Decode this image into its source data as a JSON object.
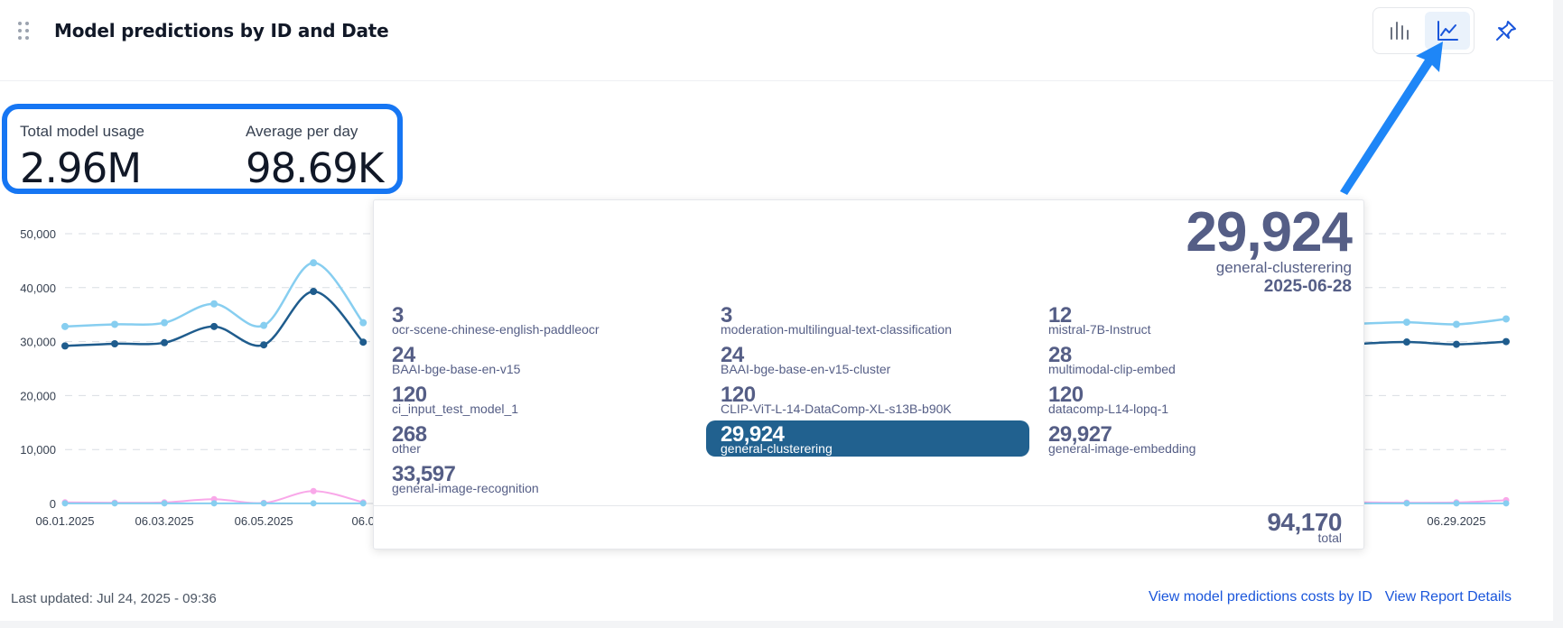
{
  "header": {
    "title": "Model predictions by ID and Date",
    "view_toggle": {
      "bar_icon": "bar-chart-icon",
      "line_icon": "line-chart-icon",
      "active": "line"
    },
    "pin_icon": "pin-icon"
  },
  "kpis": {
    "total_label": "Total model usage",
    "total_value": "2.96M",
    "avg_label": "Average per day",
    "avg_value": "98.69K"
  },
  "colors": {
    "accent": "#1676f3",
    "series_light": "#87cef0",
    "series_dark": "#1f5c8d",
    "series_pink": "#f9a8e9",
    "tooltip_text": "#555e86",
    "tooltip_highlight": "#21618f",
    "link": "#1a56db"
  },
  "chart_data": {
    "type": "line",
    "x_tick_labels": [
      "06.01.2025",
      "06.03.2025",
      "06.05.2025",
      "06.0",
      "06.29.2025"
    ],
    "y_tick_labels": [
      "0",
      "10,000",
      "20,000",
      "30,000",
      "40,000",
      "50,000"
    ],
    "ylim": [
      0,
      50000
    ],
    "grid": true,
    "series": [
      {
        "x": [
          "06.01.2025",
          "06.02.2025",
          "06.03.2025",
          "06.04.2025",
          "06.05.2025",
          "06.06.2025",
          "06.07.2025",
          "06.26.2025",
          "06.27.2025",
          "06.28.2025",
          "06.29.2025",
          "06.30.2025"
        ],
        "values": [
          32800,
          33200,
          33500,
          37000,
          33000,
          44600,
          33500,
          33200,
          33300,
          33600,
          33200,
          34200
        ]
      },
      {
        "x": [
          "06.01.2025",
          "06.02.2025",
          "06.03.2025",
          "06.04.2025",
          "06.05.2025",
          "06.06.2025",
          "06.07.2025",
          "06.26.2025",
          "06.27.2025",
          "06.28.2025",
          "06.29.2025",
          "06.30.2025"
        ],
        "values": [
          29200,
          29600,
          29800,
          32800,
          29400,
          39300,
          29900,
          29400,
          29600,
          29924,
          29500,
          30000
        ]
      },
      {
        "x": [
          "06.01.2025",
          "06.02.2025",
          "06.03.2025",
          "06.04.2025",
          "06.05.2025",
          "06.06.2025",
          "06.07.2025",
          "06.26.2025",
          "06.27.2025",
          "06.28.2025",
          "06.29.2025",
          "06.30.2025"
        ],
        "values": [
          200,
          150,
          200,
          800,
          100,
          2300,
          200,
          150,
          200,
          150,
          200,
          600
        ]
      },
      {
        "x": [
          "06.01.2025",
          "06.02.2025",
          "06.03.2025",
          "06.04.2025",
          "06.05.2025",
          "06.06.2025",
          "06.07.2025",
          "06.26.2025",
          "06.27.2025",
          "06.28.2025",
          "06.29.2025",
          "06.30.2025"
        ],
        "values": [
          30,
          30,
          30,
          30,
          30,
          30,
          30,
          30,
          30,
          30,
          30,
          30
        ]
      }
    ]
  },
  "tooltip": {
    "value": "29,924",
    "name": "general-clusterering",
    "date": "2025-06-28",
    "items": [
      {
        "value": "3",
        "name": "ocr-scene-chinese-english-paddleocr"
      },
      {
        "value": "3",
        "name": "moderation-multilingual-text-classification"
      },
      {
        "value": "12",
        "name": "mistral-7B-Instruct"
      },
      {
        "value": "24",
        "name": "BAAI-bge-base-en-v15"
      },
      {
        "value": "24",
        "name": "BAAI-bge-base-en-v15-cluster"
      },
      {
        "value": "28",
        "name": "multimodal-clip-embed"
      },
      {
        "value": "120",
        "name": "ci_input_test_model_1"
      },
      {
        "value": "120",
        "name": "CLIP-ViT-L-14-DataComp-XL-s13B-b90K"
      },
      {
        "value": "120",
        "name": "datacomp-L14-lopq-1"
      },
      {
        "value": "268",
        "name": "other"
      },
      {
        "value": "29,924",
        "name": "general-clusterering",
        "active": true
      },
      {
        "value": "29,927",
        "name": "general-image-embedding"
      },
      {
        "value": "33,597",
        "name": "general-image-recognition"
      }
    ],
    "total_value": "94,170",
    "total_label": "total"
  },
  "footer": {
    "last_updated": "Last updated: Jul 24, 2025 - 09:36",
    "link_costs": "View model predictions costs by ID",
    "link_details": "View Report Details"
  }
}
